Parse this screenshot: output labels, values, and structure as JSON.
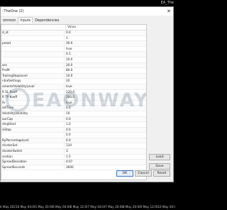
{
  "window_chart": {
    "corner_label": "EA_The",
    "time_axis": [
      "4 May 2021",
      "6 May 04:00",
      "5 May 20:00",
      "6 May 04:00",
      "6 May 12:00",
      "7 May 04:00",
      "7 May 20:00",
      "8 May 20:00",
      "9 May 12:00",
      "10 May 04:00"
    ]
  },
  "dialog": {
    "title": "- TheOne (2)",
    "close_icon": "close-icon",
    "tabs": [
      "ommon",
      "Inputs",
      "Dependencies"
    ],
    "active_tab": 1,
    "columns": [
      "",
      "Value"
    ],
    "rows": [
      [
        "d_id",
        "0.0"
      ],
      [
        "",
        "1"
      ],
      [
        "pread",
        "30.0"
      ],
      [
        "",
        "true"
      ],
      [
        "",
        "0.1"
      ],
      [
        "",
        "10.0"
      ],
      [
        "oss",
        "20.0"
      ],
      [
        "Profit",
        "80.0"
      ],
      [
        "TrailingStopLevel",
        "10.0"
      ],
      [
        "ntialSettings",
        "20"
      ],
      [
        "amentrlVolatilityLevel",
        "true"
      ],
      [
        "R SL Koeff",
        "120.0"
      ],
      [
        "R TP Koeff",
        "180.0"
      ],
      [
        "fe",
        "true"
      ],
      [
        "artTime",
        "0.0"
      ],
      [
        "VolatilityVolatility",
        "10"
      ],
      [
        "ourCap",
        "0.0"
      ],
      [
        "dingStart",
        "1.0"
      ],
      [
        "isStop",
        "0.0"
      ],
      [
        "",
        "0.0"
      ],
      [
        "ByPercentageLost",
        "0.0"
      ],
      [
        "dicatorSet",
        "134"
      ],
      [
        "dicatorSwitch",
        "3"
      ],
      [
        "oration",
        "1.5"
      ],
      [
        "SpreadDeviation",
        "0.07"
      ],
      [
        "SpreadSeconds",
        "3600"
      ]
    ],
    "watermark": "EAONWAY",
    "side_buttons": [
      "Load",
      "Save"
    ],
    "bottom_buttons": [
      "OK",
      "Cancel",
      "Reset"
    ]
  }
}
